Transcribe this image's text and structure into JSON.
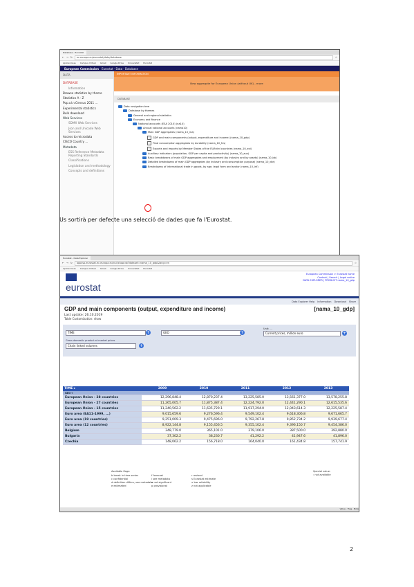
{
  "caption": "Us sortirà per defecte una selecció de dades que fa l'Eurostat.",
  "page_number": "2",
  "shot1": {
    "tab_title": "Database - Eurostat",
    "url": "ec.europa.eu/eurostat/data/database",
    "bookmarks": [
      "Aplicaciones",
      "Campus Virtual",
      "Gmail",
      "Google Drive",
      "Universitat",
      "Eurostat"
    ],
    "ec_bar": {
      "brand": "European Commission",
      "path": "Eurostat · Data · Database"
    },
    "sidebar": {
      "header": "DATA",
      "items": [
        {
          "label": "DATABASE",
          "style": "red"
        },
        {
          "label": "Information",
          "style": "sub"
        },
        {
          "label": "Browse statistics by theme",
          "style": "normal"
        },
        {
          "label": "Statistics A - Z",
          "style": "normal"
        },
        {
          "label": "Pop.ul.n.Census 2011 ...",
          "style": "normal"
        },
        {
          "label": "Experimental statistics",
          "style": "normal"
        },
        {
          "label": "Bulk download",
          "style": "normal"
        },
        {
          "label": "Web Services",
          "style": "blue"
        },
        {
          "label": "SDMX Web Services",
          "style": "sub"
        },
        {
          "label": "Json and Unicode Web Services",
          "style": "sub"
        },
        {
          "label": "Access to microdata",
          "style": "normal"
        },
        {
          "label": "CISCO Country ...",
          "style": "normal"
        },
        {
          "label": "Metadata",
          "style": "blue"
        },
        {
          "label": "ESS Reference Metadata Reporting Standards",
          "style": "sub"
        },
        {
          "label": "Classifications",
          "style": "sub"
        },
        {
          "label": "Legislation and methodology",
          "style": "sub"
        },
        {
          "label": "Concepts and definitions",
          "style": "sub"
        }
      ]
    },
    "notice_header": "IMPORTANT INFORMATION",
    "notice_text": "New aggregate for European Union (without UK) - more",
    "database_header": "DATABASE",
    "tree": [
      {
        "level": 0,
        "label": "Data navigation tree",
        "icon": "folder"
      },
      {
        "level": 1,
        "label": "Database by themes",
        "icon": "folder"
      },
      {
        "level": 2,
        "label": "General and regional statistics",
        "icon": "folder"
      },
      {
        "level": 2,
        "label": "Economy and finance",
        "icon": "folder"
      },
      {
        "level": 3,
        "label": "National accounts (ESA 2010) (na10)",
        "icon": "folder"
      },
      {
        "level": 4,
        "label": "Annual national accounts (nama10)",
        "icon": "folder"
      },
      {
        "level": 5,
        "label": "Main GDP aggregates (nama_10_ma)",
        "icon": "folder"
      },
      {
        "level": 6,
        "label": "GDP and main components (output, expenditure and income) (nama_10_gdp)",
        "icon": "table"
      },
      {
        "level": 6,
        "label": "Final consumption aggregates by durability (nama_10_fcs)",
        "icon": "table"
      },
      {
        "level": 6,
        "label": "Exports and imports by Member States of the EU/third countries (nama_10_exi)",
        "icon": "table"
      },
      {
        "level": 5,
        "label": "Auxiliary indicators (population, GDP per capita and productivity) (nama_10_aux)",
        "icon": "folder"
      },
      {
        "level": 5,
        "label": "Basic breakdowns of main GDP aggregates and employment (by industry and by assets) (nama_10_bb)",
        "icon": "folder"
      },
      {
        "level": 5,
        "label": "Detailed breakdowns of main GDP aggregates (by industry and consumption purpose) (nama_10_dbr)",
        "icon": "folder"
      },
      {
        "level": 5,
        "label": "Breakdowns of international trade in goods, by age, legal form and sector (nama_10_inf)",
        "icon": "folder"
      }
    ]
  },
  "shot2": {
    "tab_title": "Eurostat - Data Explorer",
    "url": "appsso.eurostat.ec.europa.eu/nui/show.do?dataset=nama_10_gdp&lang=en",
    "bookmarks": [
      "Aplicaciones",
      "Campus Virtual",
      "Gmail",
      "Google Drive",
      "Universitat",
      "Eurostat"
    ],
    "links": [
      "European Commission > Eurostat home",
      "Contact | Search | Legal notice",
      "DATA EXPLORER | PRODUCT nama_10_gdp"
    ],
    "brand": "eurostat",
    "tools": [
      "Data Explorer Help",
      "Information",
      "Download",
      "Share"
    ],
    "title": "GDP and main components (output, expenditure and income)",
    "code": "[nama_10_gdp]",
    "last_update": "Last update: 26.10.2019",
    "table_explanation": "Table Customization: show",
    "dims": {
      "time": "TIME",
      "geo": "GEO",
      "na_item": "Gross domestic product at market prices",
      "unit_label": "Unit: ...",
      "selector": "Current prices, million euro",
      "unit_dd": "Chain linked volumes"
    },
    "col_header": "TIME",
    "row_header": "GEO",
    "years": [
      "2009",
      "2010",
      "2011",
      "2012",
      "2013"
    ],
    "rows": [
      {
        "geo": "European Union - 28 countries",
        "values": [
          "12,296,848.4",
          "12,870,237.4",
          "13,225,585.0",
          "13,561,377.0",
          "13,578,255.8"
        ]
      },
      {
        "geo": "European Union - 27 countries",
        "values": [
          "11,265,005.7",
          "11,875,387.4",
          "12,224,792.0",
          "12,441,290.1",
          "12,615,535.6"
        ]
      },
      {
        "geo": "European Union - 15 countries",
        "values": [
          "11,240,562.2",
          "11,635,729.1",
          "11,917,294.0",
          "12,043,614.3",
          "12,225,587.4"
        ]
      },
      {
        "geo": "Euro area (EA11-1999, ...)",
        "values": [
          "9,015,659.6",
          "9,276,596.4",
          "9,549,102.4",
          "9,618,306.8",
          "9,671,665.7"
        ]
      },
      {
        "geo": "Euro area (19 countries)",
        "values": [
          "9,251,009.3",
          "9,475,696.0",
          "9,792,267.8",
          "9,852,734.2",
          "9,939,677.4"
        ]
      },
      {
        "geo": "Euro area (12 countries)",
        "values": [
          "8,922,144.8",
          "9,155,456.5",
          "9,355,102.4",
          "9,396,150.7",
          "9,454,386.0"
        ]
      },
      {
        "geo": "Belgium",
        "values": [
          "348,779.0",
          "365,101.0",
          "379,106.0",
          "387,500.0",
          "392,880.0"
        ]
      },
      {
        "geo": "Bulgaria",
        "values": [
          "37,302.2",
          "38,230.7",
          "41,292.2",
          "41,947.6",
          "41,896.0"
        ]
      },
      {
        "geo": "Czechia",
        "values": [
          "148,062.2",
          "156,718.0",
          "164,040.0",
          "161,434.8",
          "157,741.9"
        ]
      }
    ],
    "flags": [
      {
        "code": "b",
        "text": "break in time series"
      },
      {
        "code": "c",
        "text": "confidential"
      },
      {
        "code": "d",
        "text": "definition differs, see metadata"
      },
      {
        "code": "e",
        "text": "estimated"
      },
      {
        "code": "f",
        "text": "forecast"
      },
      {
        "code": "i",
        "text": "see metadata"
      },
      {
        "code": "n",
        "text": "not significant"
      },
      {
        "code": "p",
        "text": "provisional"
      },
      {
        "code": "r",
        "text": "revised"
      },
      {
        "code": "s",
        "text": "Eurostat estimate"
      },
      {
        "code": "u",
        "text": "low reliability"
      },
      {
        "code": "z",
        "text": "not applicable"
      }
    ],
    "flags_title": "Available flags:",
    "special_value": "Special value:",
    "special_value_desc": ": not available",
    "footer": "Value · Flag · Note"
  }
}
